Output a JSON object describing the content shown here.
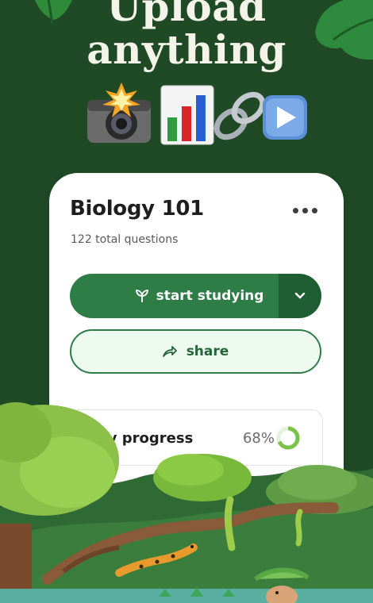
{
  "headline": {
    "line1": "Upload",
    "line2": "anything"
  },
  "emoji_icons": [
    "camera-flash-icon",
    "bar-chart-icon",
    "link-icon",
    "play-button-icon"
  ],
  "card": {
    "title": "Biology 101",
    "subtitle": "122 total questions",
    "study_button_label": "start studying",
    "share_button_label": "share",
    "progress": {
      "label": "my progress",
      "percent_text": "68%",
      "value": 0.68
    }
  },
  "colors": {
    "background": "#1f4a25",
    "primary_green": "#2e7d46",
    "dark_green": "#1f5e32",
    "share_bg": "#eefaf0",
    "ring_color": "#7cc24a"
  }
}
